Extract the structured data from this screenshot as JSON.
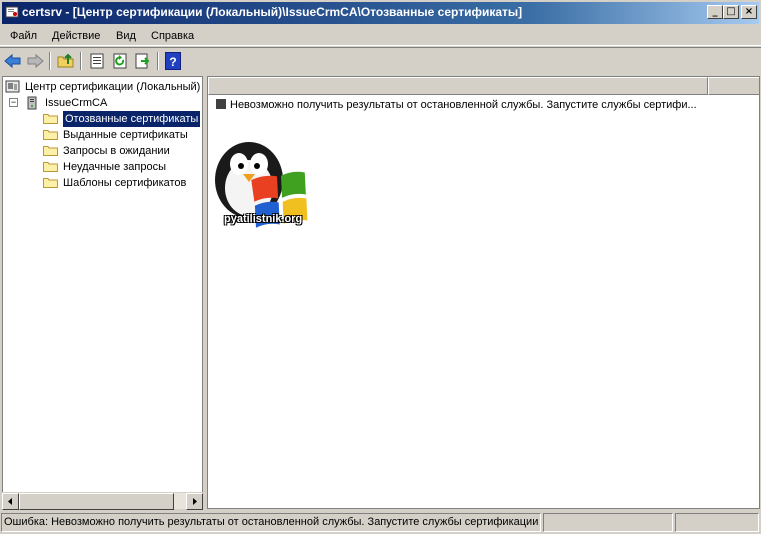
{
  "window": {
    "title": "certsrv - [Центр сертификации (Локальный)\\IssueCrmCA\\Отозванные сертификаты]",
    "controls": {
      "minimize": "_",
      "maximize": "□",
      "close": "×"
    }
  },
  "menu": {
    "items": [
      "Файл",
      "Действие",
      "Вид",
      "Справка"
    ]
  },
  "toolbar": {
    "buttons": [
      "back-arrow-icon",
      "forward-arrow-icon",
      "up-folder-icon",
      "properties-icon",
      "refresh-icon",
      "export-icon",
      "help-icon"
    ],
    "help_label": "?"
  },
  "tree": {
    "root": "Центр сертификации (Локальный)",
    "ca": "IssueCrmCA",
    "expander": "−",
    "folders": [
      "Отозванные сертификаты",
      "Выданные сертификаты",
      "Запросы в ожидании",
      "Неудачные запросы",
      "Шаблоны сертификатов"
    ],
    "selected_index": 0
  },
  "list": {
    "message": "Невозможно получить результаты от остановленной службы. Запустите службы сертифи..."
  },
  "watermark": {
    "text": "pyatilistnik.org"
  },
  "status": {
    "main": "Ошибка: Невозможно получить результаты от остановленной службы. Запустите службы сертификации",
    "pane2": "",
    "pane3": ""
  },
  "colors": {
    "title_start": "#0a246a",
    "title_end": "#a6caf0",
    "selection": "#0a246a",
    "face": "#d4d0c8"
  }
}
